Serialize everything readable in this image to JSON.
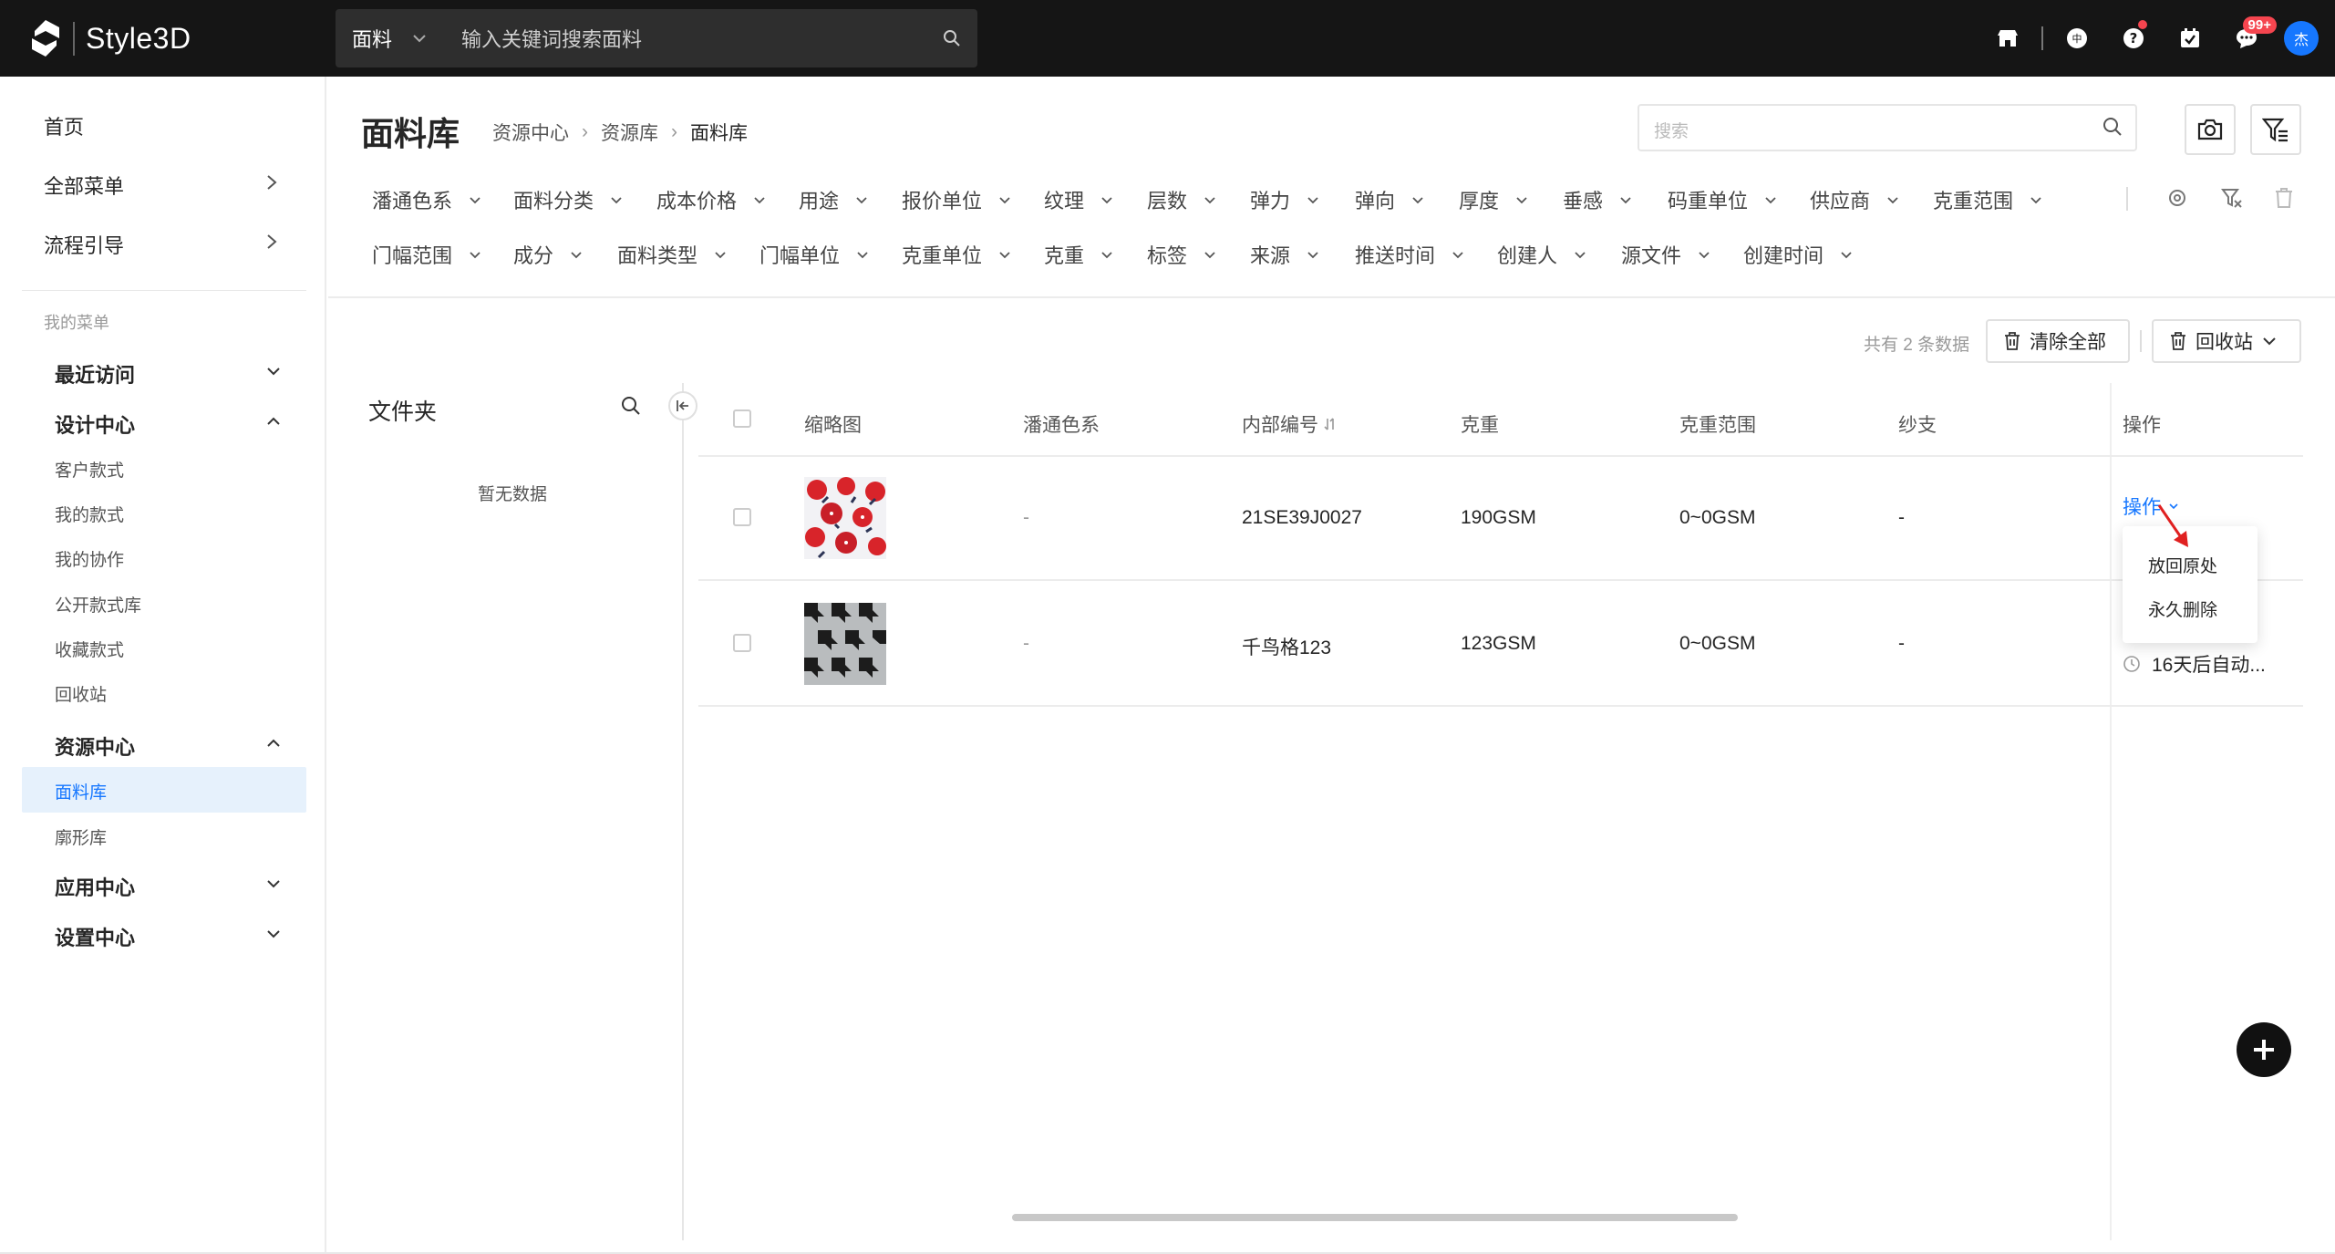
{
  "app": {
    "logo_text": "Style3D"
  },
  "topbar": {
    "search_category": "面料",
    "search_placeholder": "输入关键词搜索面料",
    "badge": "99+",
    "avatar_initial": "杰"
  },
  "sidebar": {
    "home": "首页",
    "all_menu": "全部菜单",
    "flow_guide": "流程引导",
    "my_menu_label": "我的菜单",
    "groups": {
      "recent": "最近访问",
      "design": "设计中心",
      "resource": "资源中心",
      "apps": "应用中心",
      "settings": "设置中心"
    },
    "design_items": [
      "客户款式",
      "我的款式",
      "我的协作",
      "公开款式库",
      "收藏款式",
      "回收站"
    ],
    "resource_items": [
      "面料库",
      "廓形库"
    ]
  },
  "header": {
    "title": "面料库",
    "breadcrumb": [
      "资源中心",
      "资源库",
      "面料库"
    ],
    "search_placeholder": "搜索"
  },
  "filters": {
    "row1": [
      "潘通色系",
      "面料分类",
      "成本价格",
      "用途",
      "报价单位",
      "纹理",
      "层数",
      "弹力",
      "弹向",
      "厚度",
      "垂感",
      "码重单位",
      "供应商",
      "克重范围"
    ],
    "row2": [
      "门幅范围",
      "成分",
      "面料类型",
      "门幅单位",
      "克重单位",
      "克重",
      "标签",
      "来源",
      "推送时间",
      "创建人",
      "源文件",
      "创建时间"
    ]
  },
  "toolbar": {
    "count_text": "共有 2 条数据",
    "clear_all": "清除全部",
    "recycle_bin": "回收站"
  },
  "folder": {
    "title": "文件夹",
    "empty": "暂无数据"
  },
  "table": {
    "headers": [
      "缩略图",
      "潘通色系",
      "内部编号",
      "克重",
      "克重范围",
      "纱支",
      "操作"
    ],
    "rows": [
      {
        "pantone": "-",
        "code": "21SE39J0027",
        "weight": "190GSM",
        "weight_range": "0~0GSM",
        "yarn": "-"
      },
      {
        "pantone": "-",
        "code": "千鸟格123",
        "weight": "123GSM",
        "weight_range": "0~0GSM",
        "yarn": "-"
      }
    ],
    "op_label": "操作",
    "dropdown": [
      "放回原处",
      "永久删除"
    ],
    "auto_delete": "16天后自动..."
  },
  "colors": {
    "topbar_bg": "#151515",
    "accent": "#1677ff",
    "active_bg": "#e6f1fc",
    "badge_red": "#f5454f"
  }
}
